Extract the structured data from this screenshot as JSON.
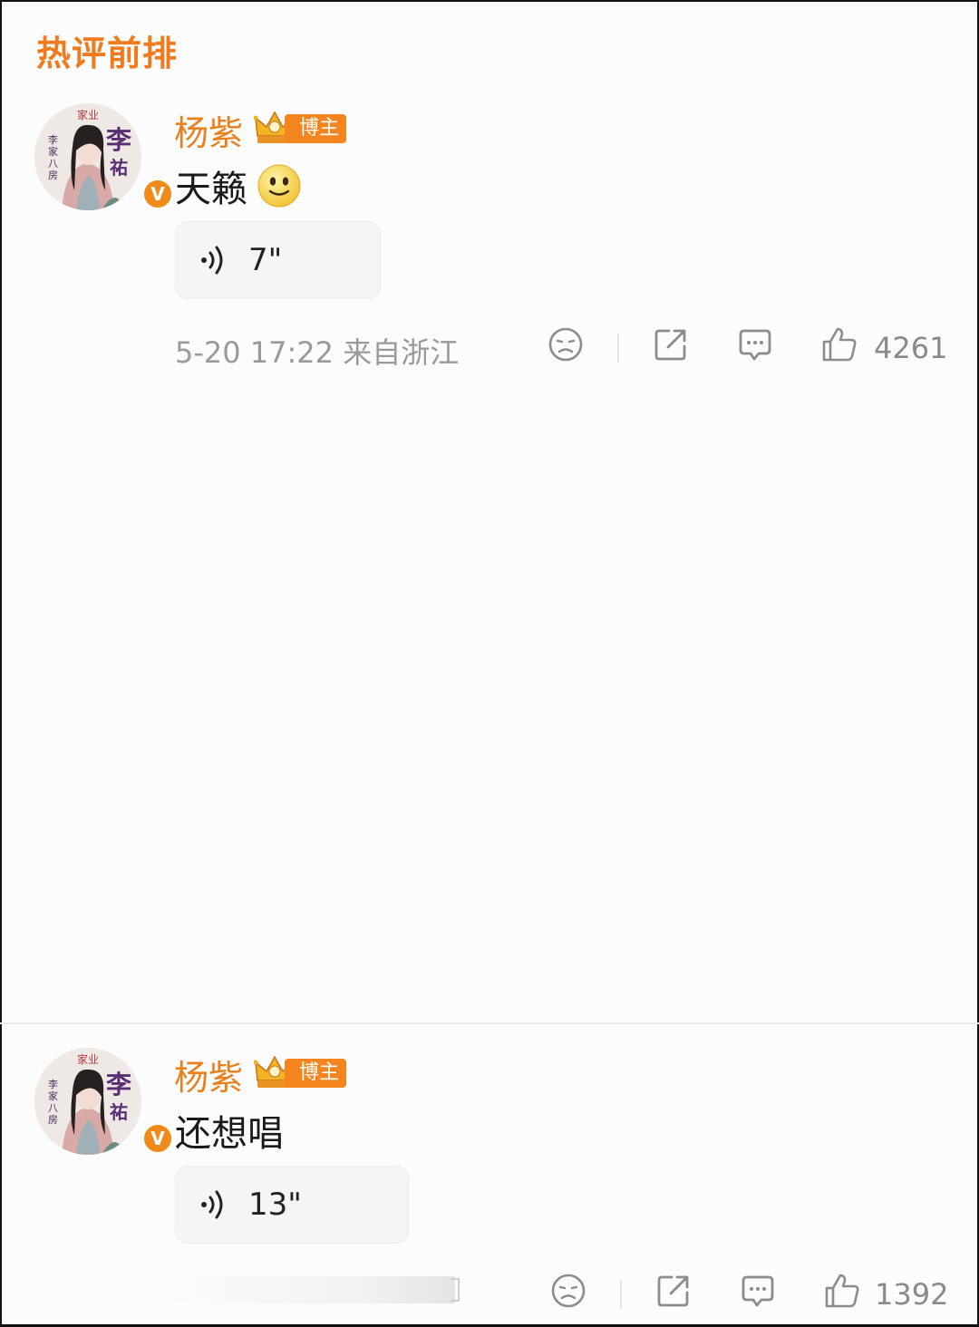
{
  "section_title": "热评前排",
  "comments": [
    {
      "author": "杨紫",
      "badge": "博主",
      "text": "天籁",
      "has_emoji": true,
      "voice_duration": "7\"",
      "meta": "5-20 17:22 来自浙江",
      "likes": "4261"
    },
    {
      "author": "杨紫",
      "badge": "博主",
      "text": "还想唱",
      "has_emoji": false,
      "voice_duration": "13\"",
      "meta": "",
      "likes": "1392"
    }
  ],
  "avatar": {
    "poster_text_top": "家业",
    "poster_text_big": "李祐",
    "poster_text_side": "李家八房",
    "verified_mark": "V"
  },
  "icons": {
    "sad": "sad-face-icon",
    "share": "share-icon",
    "comment": "comment-icon",
    "like": "thumbs-up-icon",
    "voice": "sound-wave-icon",
    "emoji": "smiley-emoji-icon",
    "crown": "crown-icon"
  },
  "colors": {
    "accent": "#f07a1c",
    "author": "#e8801c",
    "verified": "#f08a18",
    "muted": "#9a9a9a"
  }
}
